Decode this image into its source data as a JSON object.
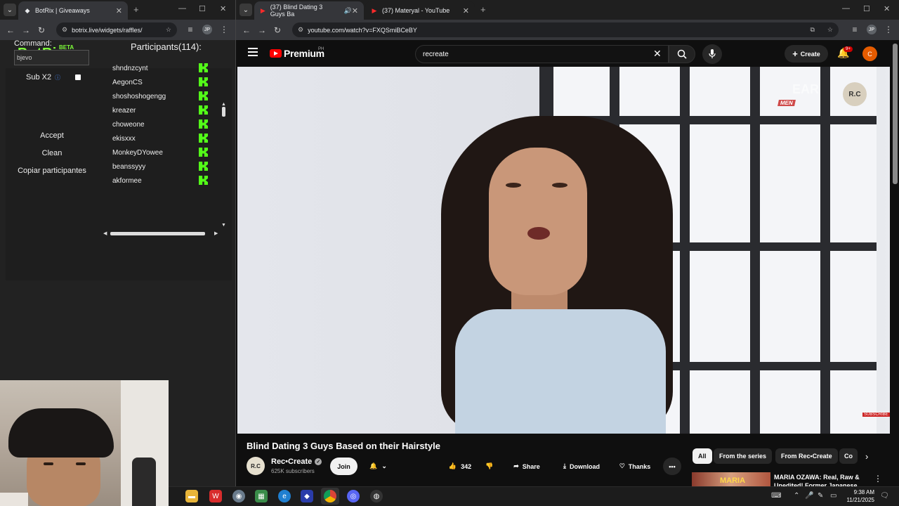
{
  "left_window": {
    "tab_title": "BotRix | Giveaways",
    "url": "botrix.live/widgets/raffles/",
    "profile": "JP"
  },
  "botrix": {
    "logo": "BotRix",
    "beta": "BETA",
    "command_label": "Command:",
    "command_value": "bjevo",
    "sub_label": "Sub X2",
    "accept": "Accept",
    "clean": "Clean",
    "copy": "Copiar participantes",
    "participants_title": "Participants(114):",
    "participants": [
      "shndnzcynt",
      "AegonCS",
      "shoshoshogengg",
      "kreazer",
      "choweone",
      "ekisxxx",
      "MonkeyDYowee",
      "beanssyyy",
      "akformee"
    ]
  },
  "right_window": {
    "tabs": [
      {
        "title": "(37) Blind Dating 3 Guys Ba"
      },
      {
        "title": "(37) Materyal - YouTube"
      }
    ],
    "url": "youtube.com/watch?v=FXQSmiBCeBY",
    "profile": "JP"
  },
  "youtube": {
    "brand": "Premium",
    "region": "PH",
    "search_value": "recreate",
    "create_label": "Create",
    "notif_badge": "9+",
    "user_initial": "C",
    "video_watermark": "EAR",
    "video_watermark_tag": "MEN",
    "video_channel_bug": "R.C",
    "video_subscribe": "SUBSCRIBE",
    "title": "Blind Dating 3 Guys Based on their Hairstyle",
    "channel_avatar": "R.C",
    "channel": "Rec•Create",
    "subscribers": "625K subscribers",
    "join": "Join",
    "likes": "342",
    "share": "Share",
    "download": "Download",
    "thanks": "Thanks",
    "chips": [
      "All",
      "From the series",
      "From Rec•Create",
      "Co"
    ],
    "rec_thumb_text": "MARIA",
    "rec_title": "MARIA OZAWA: Real, Raw & Unedited! Former Japanese"
  },
  "taskbar": {
    "time": "9:38 AM",
    "date": "11/21/2025"
  },
  "colors": {
    "botrix_green": "#7fff3a",
    "kick_green": "#53fc18",
    "yt_red": "#ff0000"
  }
}
